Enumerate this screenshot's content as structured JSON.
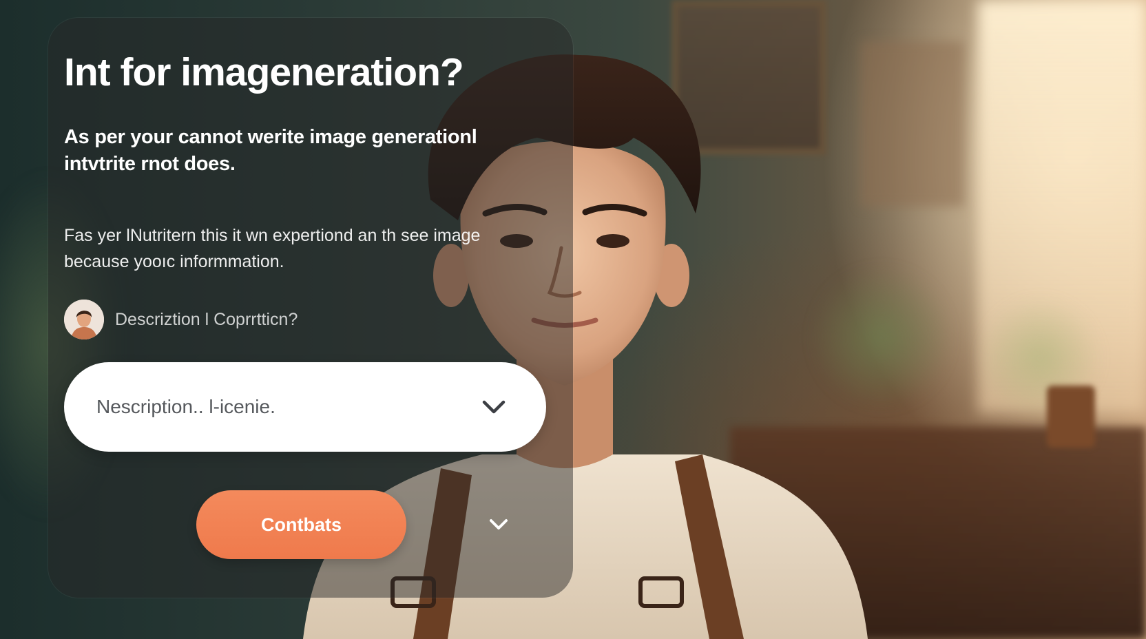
{
  "dialog": {
    "title": "Int for imageneration?",
    "subtitle": "As per your cannot werite image generationl intvtrite rnot does.",
    "body": "Fas yer lNutritern this it wn expertiond an th see image  because yooıc informmation.",
    "user_label": "Descriztion l Coprrtticn?",
    "select": {
      "value": "Nescription.. l-icenie."
    },
    "primary_button_label": "Contbats"
  },
  "colors": {
    "card_overlay": "#282828",
    "button_accent": "#f0804f",
    "select_bg": "#ffffff",
    "select_text": "#55585c"
  },
  "icons": {
    "select_chevron": "chevron-down-icon",
    "extra_chevron": "chevron-down-icon",
    "avatar": "user-avatar"
  }
}
